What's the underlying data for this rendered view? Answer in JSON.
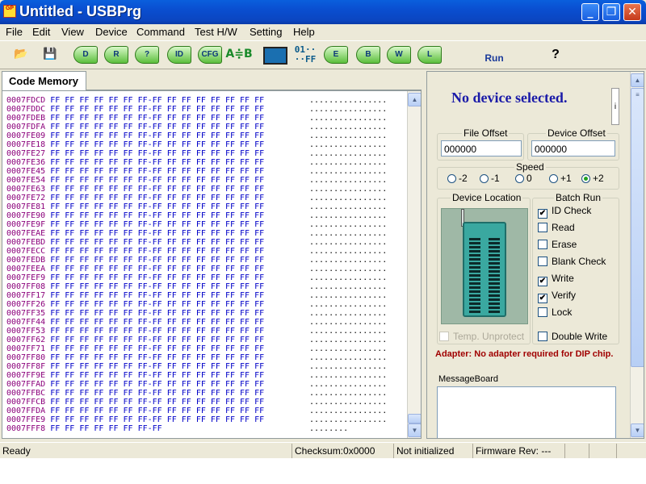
{
  "window": {
    "title": "Untitled - USBPrg",
    "logo_text": "GP"
  },
  "menu": [
    "File",
    "Edit",
    "View",
    "Device",
    "Command",
    "Test H/W",
    "Setting",
    "Help"
  ],
  "toolbar": {
    "d": "D",
    "r": "R",
    "v": "?",
    "id": "ID",
    "cfg": "CFG",
    "compare": "A≑B",
    "fill_top": "01··",
    "fill_bottom": "··FF",
    "e": "E",
    "b": "B",
    "w": "W",
    "l": "L",
    "run": "Run",
    "help": "?"
  },
  "tab": {
    "label": "Code Memory"
  },
  "hex": {
    "rows": [
      {
        "addr": "0007FDCD",
        "bytes": "FF FF FF FF FF FF FF-FF FF FF FF FF FF FF FF",
        "ascii": "................"
      },
      {
        "addr": "0007FDDC",
        "bytes": "FF FF FF FF FF FF FF-FF FF FF FF FF FF FF FF",
        "ascii": "................"
      },
      {
        "addr": "0007FDEB",
        "bytes": "FF FF FF FF FF FF FF-FF FF FF FF FF FF FF FF",
        "ascii": "................"
      },
      {
        "addr": "0007FDFA",
        "bytes": "FF FF FF FF FF FF FF-FF FF FF FF FF FF FF FF",
        "ascii": "................"
      },
      {
        "addr": "0007FE09",
        "bytes": "FF FF FF FF FF FF FF-FF FF FF FF FF FF FF FF",
        "ascii": "................"
      },
      {
        "addr": "0007FE18",
        "bytes": "FF FF FF FF FF FF FF-FF FF FF FF FF FF FF FF",
        "ascii": "................"
      },
      {
        "addr": "0007FE27",
        "bytes": "FF FF FF FF FF FF FF-FF FF FF FF FF FF FF FF",
        "ascii": "................"
      },
      {
        "addr": "0007FE36",
        "bytes": "FF FF FF FF FF FF FF-FF FF FF FF FF FF FF FF",
        "ascii": "................"
      },
      {
        "addr": "0007FE45",
        "bytes": "FF FF FF FF FF FF FF-FF FF FF FF FF FF FF FF",
        "ascii": "................"
      },
      {
        "addr": "0007FE54",
        "bytes": "FF FF FF FF FF FF FF-FF FF FF FF FF FF FF FF",
        "ascii": "................"
      },
      {
        "addr": "0007FE63",
        "bytes": "FF FF FF FF FF FF FF-FF FF FF FF FF FF FF FF",
        "ascii": "................"
      },
      {
        "addr": "0007FE72",
        "bytes": "FF FF FF FF FF FF FF-FF FF FF FF FF FF FF FF",
        "ascii": "................"
      },
      {
        "addr": "0007FE81",
        "bytes": "FF FF FF FF FF FF FF-FF FF FF FF FF FF FF FF",
        "ascii": "................"
      },
      {
        "addr": "0007FE90",
        "bytes": "FF FF FF FF FF FF FF-FF FF FF FF FF FF FF FF",
        "ascii": "................"
      },
      {
        "addr": "0007FE9F",
        "bytes": "FF FF FF FF FF FF FF-FF FF FF FF FF FF FF FF",
        "ascii": "................"
      },
      {
        "addr": "0007FEAE",
        "bytes": "FF FF FF FF FF FF FF-FF FF FF FF FF FF FF FF",
        "ascii": "................"
      },
      {
        "addr": "0007FEBD",
        "bytes": "FF FF FF FF FF FF FF-FF FF FF FF FF FF FF FF",
        "ascii": "................"
      },
      {
        "addr": "0007FECC",
        "bytes": "FF FF FF FF FF FF FF-FF FF FF FF FF FF FF FF",
        "ascii": "................"
      },
      {
        "addr": "0007FEDB",
        "bytes": "FF FF FF FF FF FF FF-FF FF FF FF FF FF FF FF",
        "ascii": "................"
      },
      {
        "addr": "0007FEEA",
        "bytes": "FF FF FF FF FF FF FF-FF FF FF FF FF FF FF FF",
        "ascii": "................"
      },
      {
        "addr": "0007FEF9",
        "bytes": "FF FF FF FF FF FF FF-FF FF FF FF FF FF FF FF",
        "ascii": "................"
      },
      {
        "addr": "0007FF08",
        "bytes": "FF FF FF FF FF FF FF-FF FF FF FF FF FF FF FF",
        "ascii": "................"
      },
      {
        "addr": "0007FF17",
        "bytes": "FF FF FF FF FF FF FF-FF FF FF FF FF FF FF FF",
        "ascii": "................"
      },
      {
        "addr": "0007FF26",
        "bytes": "FF FF FF FF FF FF FF-FF FF FF FF FF FF FF FF",
        "ascii": "................"
      },
      {
        "addr": "0007FF35",
        "bytes": "FF FF FF FF FF FF FF-FF FF FF FF FF FF FF FF",
        "ascii": "................"
      },
      {
        "addr": "0007FF44",
        "bytes": "FF FF FF FF FF FF FF-FF FF FF FF FF FF FF FF",
        "ascii": "................"
      },
      {
        "addr": "0007FF53",
        "bytes": "FF FF FF FF FF FF FF-FF FF FF FF FF FF FF FF",
        "ascii": "................"
      },
      {
        "addr": "0007FF62",
        "bytes": "FF FF FF FF FF FF FF-FF FF FF FF FF FF FF FF",
        "ascii": "................"
      },
      {
        "addr": "0007FF71",
        "bytes": "FF FF FF FF FF FF FF-FF FF FF FF FF FF FF FF",
        "ascii": "................"
      },
      {
        "addr": "0007FF80",
        "bytes": "FF FF FF FF FF FF FF-FF FF FF FF FF FF FF FF",
        "ascii": "................"
      },
      {
        "addr": "0007FF8F",
        "bytes": "FF FF FF FF FF FF FF-FF FF FF FF FF FF FF FF",
        "ascii": "................"
      },
      {
        "addr": "0007FF9E",
        "bytes": "FF FF FF FF FF FF FF-FF FF FF FF FF FF FF FF",
        "ascii": "................"
      },
      {
        "addr": "0007FFAD",
        "bytes": "FF FF FF FF FF FF FF-FF FF FF FF FF FF FF FF",
        "ascii": "................"
      },
      {
        "addr": "0007FFBC",
        "bytes": "FF FF FF FF FF FF FF-FF FF FF FF FF FF FF FF",
        "ascii": "................"
      },
      {
        "addr": "0007FFCB",
        "bytes": "FF FF FF FF FF FF FF-FF FF FF FF FF FF FF FF",
        "ascii": "................"
      },
      {
        "addr": "0007FFDA",
        "bytes": "FF FF FF FF FF FF FF-FF FF FF FF FF FF FF FF",
        "ascii": "................"
      },
      {
        "addr": "0007FFE9",
        "bytes": "FF FF FF FF FF FF FF-FF FF FF FF FF FF FF FF",
        "ascii": "................"
      },
      {
        "addr": "0007FFF8",
        "bytes": "FF FF FF FF FF FF FF-FF",
        "ascii": "........"
      }
    ]
  },
  "device": {
    "status": "No device selected.",
    "info_button": "i"
  },
  "offsets": {
    "file_label": "File Offset",
    "file_value": "000000",
    "device_label": "Device Offset",
    "device_value": "000000"
  },
  "speed": {
    "label": "Speed",
    "options": [
      "-2",
      "-1",
      "0",
      "+1",
      "+2"
    ],
    "selected": "+2"
  },
  "location": {
    "label": "Device Location",
    "temp_unprotect": "Temp. Unprotect"
  },
  "batch": {
    "label": "Batch Run",
    "items": [
      {
        "label": "ID Check",
        "checked": true
      },
      {
        "label": "Read",
        "checked": false
      },
      {
        "label": "Erase",
        "checked": false
      },
      {
        "label": "Blank Check",
        "checked": false
      },
      {
        "label": "Write",
        "checked": true
      },
      {
        "label": "Verify",
        "checked": true
      },
      {
        "label": "Lock",
        "checked": false
      }
    ],
    "double_write": "Double Write"
  },
  "adapter": {
    "text": "Adapter: No adapter required for DIP chip."
  },
  "message_board": {
    "label": "MessageBoard"
  },
  "status": {
    "ready": "Ready",
    "checksum": "Checksum:0x0000",
    "init": "Not initialized",
    "firmware": "Firmware Rev: ---"
  },
  "colors": {
    "titlebar": "#0a4ed0",
    "address": "#8b007b",
    "bytes": "#0000c8",
    "device_status": "#1a1aa8",
    "adapter": "#a00000"
  }
}
